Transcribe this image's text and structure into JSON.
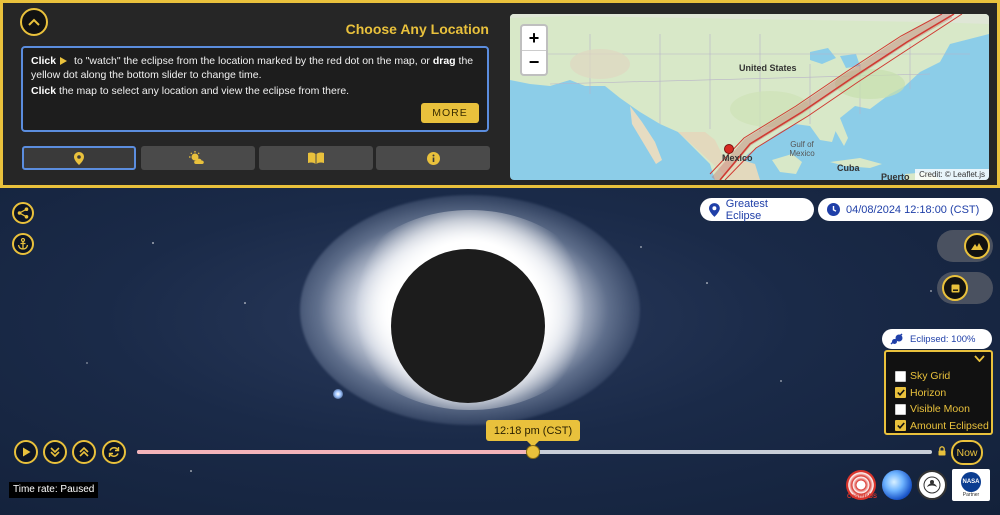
{
  "panel": {
    "title": "Choose Any Location",
    "instructions": {
      "line1_click": "Click",
      "line1_a": " to \"watch\" the eclipse from the location marked by the red dot on the map, or ",
      "line1_drag": "drag",
      "line1_b": " the yellow dot along the bottom slider to change time.",
      "line2_click": "Click",
      "line2_rest": " the map to select any location and view the eclipse from there."
    },
    "more_label": "MORE",
    "tabs": [
      {
        "icon": "location-pin-icon",
        "active": true
      },
      {
        "icon": "weather-icon",
        "active": false
      },
      {
        "icon": "book-icon",
        "active": false
      },
      {
        "icon": "info-icon",
        "active": false
      }
    ]
  },
  "map": {
    "zoom_in": "+",
    "zoom_out": "−",
    "labels": {
      "united_states": "United States",
      "mexico": "Mexico",
      "gulf_of_mexico": "Gulf of\nMexico",
      "cuba": "Cuba",
      "puerto": "Puerto"
    },
    "credit": "Credit: © Leaflet.js"
  },
  "view": {
    "greatest_eclipse": "Greatest Eclipse",
    "datetime": "04/08/2024 12:18:00 (CST)",
    "eclipsed": "Eclipsed: 100%"
  },
  "options": [
    {
      "label": "Sky Grid",
      "checked": false
    },
    {
      "label": "Horizon",
      "checked": true
    },
    {
      "label": "Visible Moon",
      "checked": false
    },
    {
      "label": "Amount Eclipsed",
      "checked": true
    }
  ],
  "timeline": {
    "time_tooltip": "12:18 pm (CST)",
    "progress": 0.49,
    "now_label": "Now",
    "time_rate": "Time rate: Paused"
  },
  "logos": {
    "cosmicds": "CosmicDS",
    "nasa": "NASA",
    "nasa_partner": "Partner"
  },
  "colors": {
    "accent": "#e9c13c",
    "link_blue": "#1f3fa8",
    "focus_blue": "#5b8dde"
  }
}
